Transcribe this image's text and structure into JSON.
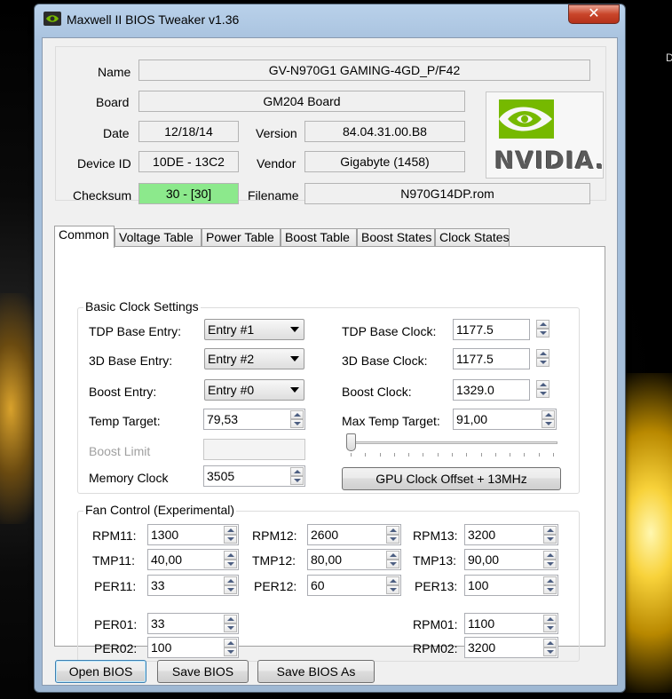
{
  "window": {
    "title": "Maxwell II BIOS Tweaker v1.36",
    "close_glyph": "✕"
  },
  "desktop": {
    "glyph": "D"
  },
  "info": {
    "name_label": "Name",
    "name_value": "GV-N970G1 GAMING-4GD_P/F42",
    "board_label": "Board",
    "board_value": "GM204 Board",
    "date_label": "Date",
    "date_value": "12/18/14",
    "version_label": "Version",
    "version_value": "84.04.31.00.B8",
    "device_label": "Device ID",
    "device_value": "10DE - 13C2",
    "vendor_label": "Vendor",
    "vendor_value": "Gigabyte (1458)",
    "checksum_label": "Checksum",
    "checksum_value": "30 - [30]",
    "filename_label": "Filename",
    "filename_value": "N970G14DP.rom",
    "logo_text": "NVIDIA."
  },
  "tabs": [
    "Common",
    "Voltage Table",
    "Power Table",
    "Boost Table",
    "Boost States",
    "Clock States"
  ],
  "basic": {
    "title": "Basic Clock Settings",
    "tdp_entry_label": "TDP Base Entry:",
    "tdp_entry_value": "Entry #1",
    "d3_entry_label": "3D Base Entry:",
    "d3_entry_value": "Entry #2",
    "boost_entry_label": "Boost Entry:",
    "boost_entry_value": "Entry #0",
    "temp_target_label": "Temp Target:",
    "temp_target_value": "79,53",
    "boost_limit_label": "Boost Limit",
    "memory_clock_label": "Memory Clock",
    "memory_clock_value": "3505",
    "tdp_clock_label": "TDP Base Clock:",
    "tdp_clock_value": "1177.5",
    "d3_clock_label": "3D Base Clock:",
    "d3_clock_value": "1177.5",
    "boost_clock_label": "Boost Clock:",
    "boost_clock_value": "1329.0",
    "max_temp_label": "Max Temp Target:",
    "max_temp_value": "91,00",
    "slider_position": 0,
    "gpu_offset_button": "GPU Clock Offset + 13MHz"
  },
  "fan": {
    "title": "Fan Control (Experimental)",
    "rpm11_label": "RPM11:",
    "rpm11": "1300",
    "rpm12_label": "RPM12:",
    "rpm12": "2600",
    "rpm13_label": "RPM13:",
    "rpm13": "3200",
    "tmp11_label": "TMP11:",
    "tmp11": "40,00",
    "tmp12_label": "TMP12:",
    "tmp12": "80,00",
    "tmp13_label": "TMP13:",
    "tmp13": "90,00",
    "per11_label": "PER11:",
    "per11": "33",
    "per12_label": "PER12:",
    "per12": "60",
    "per13_label": "PER13:",
    "per13": "100",
    "per01_label": "PER01:",
    "per01": "33",
    "per02_label": "PER02:",
    "per02": "100",
    "rpm01_label": "RPM01:",
    "rpm01": "1100",
    "rpm02_label": "RPM02:",
    "rpm02": "3200"
  },
  "footer": {
    "open": "Open BIOS",
    "save": "Save BIOS",
    "save_as": "Save BIOS As"
  }
}
